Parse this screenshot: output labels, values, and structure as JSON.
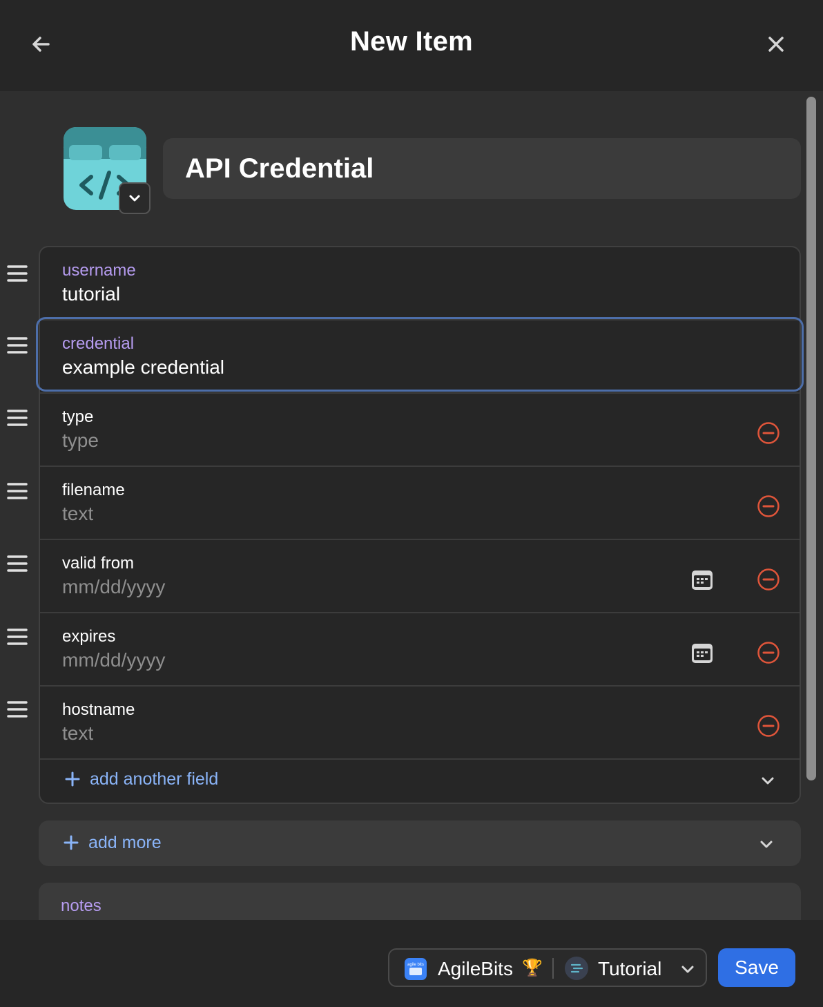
{
  "header": {
    "title": "New Item"
  },
  "item": {
    "title": "API Credential",
    "icon": "code-icon"
  },
  "fields": [
    {
      "label": "username",
      "value": "tutorial",
      "placeholder": false,
      "accent": true
    },
    {
      "label": "credential",
      "value": "example credential",
      "placeholder": false,
      "accent": true
    },
    {
      "label": "type",
      "value": "type",
      "placeholder": true,
      "accent": false
    },
    {
      "label": "filename",
      "value": "text",
      "placeholder": true,
      "accent": false
    },
    {
      "label": "valid from",
      "value": "mm/dd/yyyy",
      "placeholder": true,
      "accent": false
    },
    {
      "label": "expires",
      "value": "mm/dd/yyyy",
      "placeholder": true,
      "accent": false
    },
    {
      "label": "hostname",
      "value": "text",
      "placeholder": true,
      "accent": false
    }
  ],
  "actions": {
    "add_field": "add another field",
    "add_more": "add more"
  },
  "notes": {
    "label": "notes"
  },
  "footer": {
    "account": "AgileBits",
    "account_icon_text": "agile bits",
    "account_badge": "🏆",
    "vault": "Tutorial",
    "save": "Save"
  },
  "colors": {
    "accent_label": "#b69cf0",
    "link": "#8ab4f8",
    "remove": "#e0553a",
    "save_button": "#2f6fe4",
    "focus_border": "#4d6ea9"
  }
}
